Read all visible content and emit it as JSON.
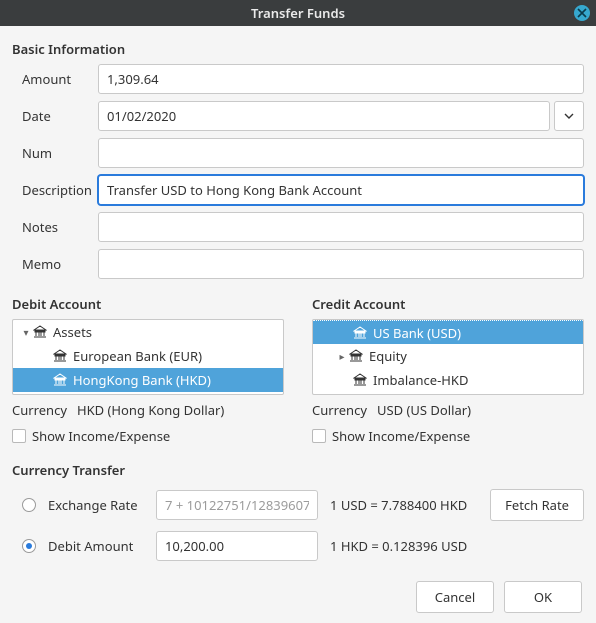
{
  "title": "Transfer Funds",
  "basic": {
    "heading": "Basic Information",
    "labels": {
      "amount": "Amount",
      "date": "Date",
      "num": "Num",
      "description": "Description",
      "notes": "Notes",
      "memo": "Memo"
    },
    "values": {
      "amount": "1,309.64",
      "date": "01/02/2020",
      "num": "",
      "description": "Transfer USD to Hong Kong Bank Account",
      "notes": "",
      "memo": ""
    }
  },
  "debit": {
    "heading": "Debit Account",
    "tree": {
      "root": "Assets",
      "children": [
        "European Bank (EUR)",
        "HongKong Bank (HKD)"
      ],
      "selected": "HongKong Bank (HKD)"
    },
    "currency_label": "Currency",
    "currency_value": "HKD (Hong Kong Dollar)",
    "show_ie": "Show Income/Expense"
  },
  "credit": {
    "heading": "Credit Account",
    "tree": {
      "items": [
        "US Bank (USD)",
        "Equity",
        "Imbalance-HKD"
      ],
      "selected": "US Bank (USD)"
    },
    "currency_label": "Currency",
    "currency_value": "USD (US Dollar)",
    "show_ie": "Show Income/Expense"
  },
  "ct": {
    "heading": "Currency Transfer",
    "rate_label": "Exchange Rate",
    "rate_value": "7 + 10122751/12839607",
    "rate_hint": "1 USD = 7.788400 HKD",
    "fetch": "Fetch Rate",
    "amt_label": "Debit Amount",
    "amt_value": "10,200.00",
    "amt_hint": "1 HKD = 0.128396 USD"
  },
  "footer": {
    "cancel": "Cancel",
    "ok": "OK"
  }
}
